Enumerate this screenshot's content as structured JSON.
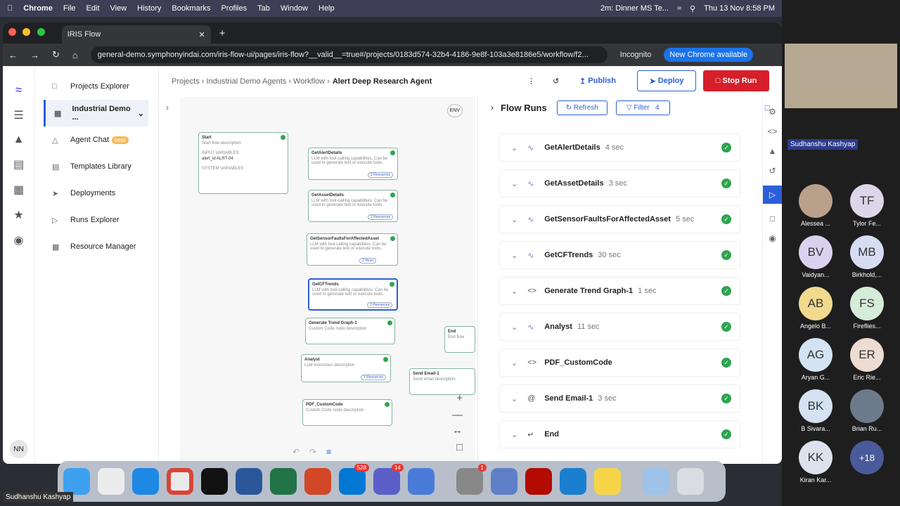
{
  "menubar": {
    "app": "Chrome",
    "items": [
      "File",
      "Edit",
      "View",
      "History",
      "Bookmarks",
      "Profiles",
      "Tab",
      "Window",
      "Help"
    ],
    "meeting": "2m: Dinner MS Te...",
    "clock": "Thu 13 Nov  8:58 PM"
  },
  "browser": {
    "tab_title": "IRIS Flow",
    "url": "general-demo.symphonyindai.com/iris-flow-ui/pages/iris-flow?__valid__=true#/projects/0183d574-32b4-4186-9e8f-103a3e8186e5/workflow/f2...",
    "incognito": "Incognito",
    "new_chrome": "New Chrome available"
  },
  "sidebar": {
    "items": [
      {
        "label": "Projects Explorer"
      },
      {
        "label": "Industrial Demo ..."
      },
      {
        "label": "Agent Chat",
        "badge": "beta"
      },
      {
        "label": "Templates Library"
      },
      {
        "label": "Deployments"
      },
      {
        "label": "Runs Explorer"
      },
      {
        "label": "Resource Manager"
      }
    ],
    "avatar": "NN"
  },
  "breadcrumb": {
    "a": "Projects",
    "b": "Industrial Demo Agents",
    "c": "Workflow",
    "current": "Alert Deep Research Agent"
  },
  "actions": {
    "publish": "Publish",
    "deploy": "Deploy",
    "stop": "Stop Run"
  },
  "canvas": {
    "start_title": "Start",
    "start_desc": "Start flow description",
    "input_vars": "INPUT VARIABLES",
    "var_name": "alert_id",
    "var_value": "ALRT-04",
    "system_vars": "SYSTEM VARIABLES",
    "nodes": [
      {
        "name": "GetAlertDetails",
        "desc": "LLM with tool-calling capabilities. Can be used to generate text or execute tools.",
        "res": "2 Resources"
      },
      {
        "name": "GetAssetDetails",
        "desc": "LLM with tool-calling capabilities. Can be used to generate text or execute tools.",
        "res": "2 Resources"
      },
      {
        "name": "GetSensorFaultsForAffectedAsset",
        "desc": "LLM with tool-calling capabilities. Can be used to generate text or execute tools.",
        "res": "2 Reso"
      },
      {
        "name": "GetCFTrends",
        "desc": "LLM with tool-calling capabilities. Can be used to generate text or execute tools.",
        "res": "3 Resources"
      },
      {
        "name": "Generate Trend Graph-1",
        "desc": "Custom Code node description"
      },
      {
        "name": "Analyst",
        "desc": "LLM instruction description",
        "res": "1 Resources"
      },
      {
        "name": "PDF_CustomCode",
        "desc": "Custom Code node description"
      },
      {
        "name": "Send Email-1",
        "desc": "Send email description"
      },
      {
        "name": "End",
        "desc": "End flow"
      }
    ],
    "env": "ENV"
  },
  "runs": {
    "title": "Flow Runs",
    "refresh": "Refresh",
    "filter": "Filter",
    "filter_count": "4",
    "rows": [
      {
        "name": "GetAlertDetails",
        "dur": "4 sec"
      },
      {
        "name": "GetAssetDetails",
        "dur": "3 sec"
      },
      {
        "name": "GetSensorFaultsForAffectedAsset",
        "dur": "5 sec"
      },
      {
        "name": "GetCFTrends",
        "dur": "30 sec"
      },
      {
        "name": "Generate Trend Graph-1",
        "dur": "1 sec"
      },
      {
        "name": "Analyst",
        "dur": "11 sec"
      },
      {
        "name": "PDF_CustomCode",
        "dur": ""
      },
      {
        "name": "Send Email-1",
        "dur": "3 sec"
      },
      {
        "name": "End",
        "dur": ""
      }
    ]
  },
  "zoom": {
    "host": "Sudhanshu Kashyap",
    "bottom_name": "Sudhanshu Kashyap",
    "participants": [
      {
        "initials": "",
        "name": "Alessea ..."
      },
      {
        "initials": "TF",
        "name": "Tylor Fe..."
      },
      {
        "initials": "BV",
        "name": "Vaidyan..."
      },
      {
        "initials": "MB",
        "name": "Birkhold,..."
      },
      {
        "initials": "AB",
        "name": "Angelo B..."
      },
      {
        "initials": "FS",
        "name": "Fireflies..."
      },
      {
        "initials": "AG",
        "name": "Aryan G..."
      },
      {
        "initials": "ER",
        "name": "Eric Rie..."
      },
      {
        "initials": "BK",
        "name": "B Sivara..."
      },
      {
        "initials": "",
        "name": "Brian Ru..."
      },
      {
        "initials": "KK",
        "name": "Kiran Kar..."
      },
      {
        "initials": "+18",
        "name": ""
      }
    ]
  },
  "dock": {
    "badge_outlook": "528",
    "badge_teams": "14",
    "badge_settings": "1"
  }
}
